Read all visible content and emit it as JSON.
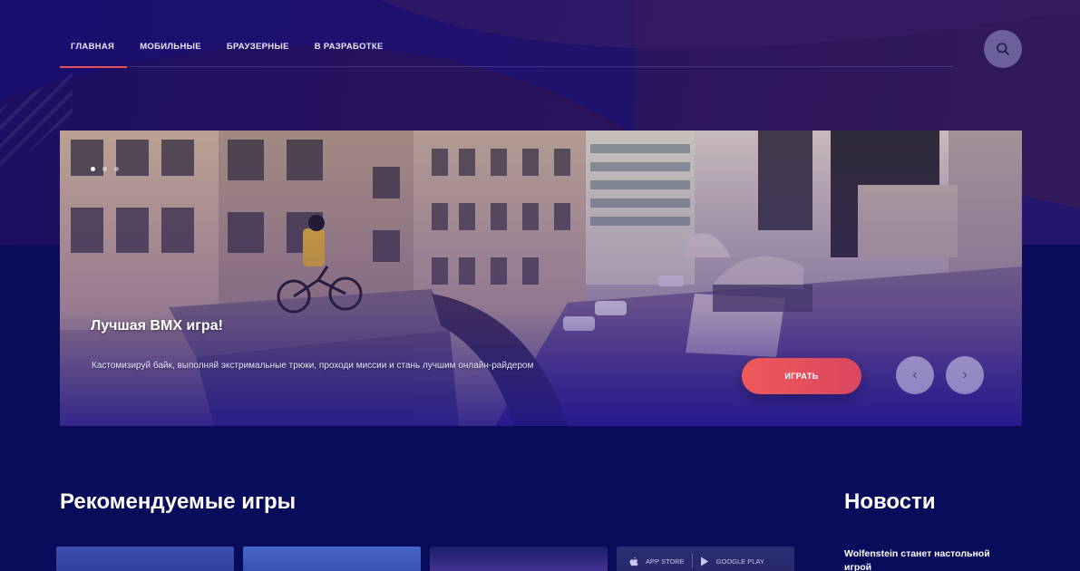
{
  "nav": {
    "items": [
      {
        "label": "ГЛАВНАЯ",
        "active": true
      },
      {
        "label": "МОБИЛЬНЫЕ",
        "active": false
      },
      {
        "label": "БРАУЗЕРНЫЕ",
        "active": false
      },
      {
        "label": "В РАЗРАБОТКЕ",
        "active": false
      }
    ],
    "search_icon": "search-icon"
  },
  "hero": {
    "title": "Лучшая BMX игра!",
    "description": "Кастомизируй байк, выполняй экстримальные трюки, проходи миссии и стань лучшим онлайн-райдером",
    "play_label": "ИГРАТЬ",
    "prev_icon": "‹",
    "next_icon": "›",
    "slides_total": 3,
    "active_slide": 1,
    "accent_color": "#e8505b"
  },
  "recommended": {
    "title": "Рекомендуемые игры",
    "cards": [
      {
        "store_labels": []
      },
      {
        "store_labels": []
      },
      {
        "store_labels": []
      },
      {
        "store_labels": [
          "APP STORE",
          "GOOGLE PLAY"
        ]
      }
    ]
  },
  "news": {
    "title": "Новости",
    "items": [
      {
        "headline": "Wolfenstein станет настольной игрой"
      }
    ]
  },
  "colors": {
    "background": "#080c5a",
    "accent": "#e8505b"
  }
}
